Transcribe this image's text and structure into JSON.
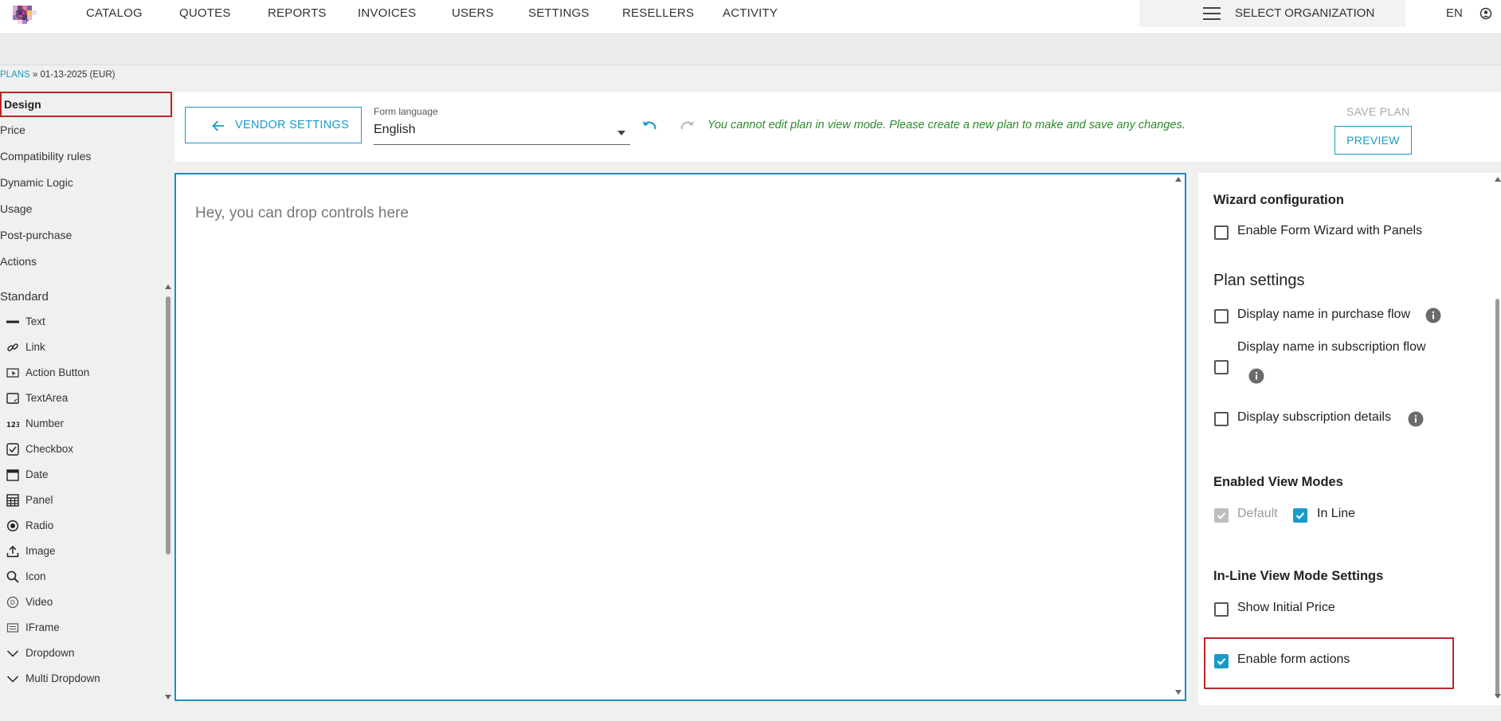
{
  "topnav": {
    "items": [
      "CATALOG",
      "QUOTES",
      "REPORTS",
      "INVOICES",
      "USERS",
      "SETTINGS",
      "RESELLERS",
      "ACTIVITY"
    ],
    "org_label": "SELECT ORGANIZATION",
    "language": "EN"
  },
  "breadcrumb": {
    "root": "PLANS",
    "separator": "»",
    "current": "01-13-2025 (EUR)"
  },
  "sidebar": {
    "sections": [
      "Design",
      "Price",
      "Compatibility rules",
      "Dynamic Logic",
      "Usage",
      "Post-purchase",
      "Actions"
    ],
    "standard_label": "Standard",
    "controls": [
      {
        "label": "Text",
        "icon": "text-icon"
      },
      {
        "label": "Link",
        "icon": "link-icon"
      },
      {
        "label": "Action Button",
        "icon": "action-button-icon"
      },
      {
        "label": "TextArea",
        "icon": "textarea-icon"
      },
      {
        "label": "Number",
        "icon": "number-icon"
      },
      {
        "label": "Checkbox",
        "icon": "checkbox-icon"
      },
      {
        "label": "Date",
        "icon": "calendar-icon"
      },
      {
        "label": "Panel",
        "icon": "panel-icon"
      },
      {
        "label": "Radio",
        "icon": "radio-icon"
      },
      {
        "label": "Image",
        "icon": "upload-icon"
      },
      {
        "label": "Icon",
        "icon": "search-icon"
      },
      {
        "label": "Video",
        "icon": "video-icon"
      },
      {
        "label": "IFrame",
        "icon": "iframe-icon"
      },
      {
        "label": "Dropdown",
        "icon": "chevron-down-icon"
      },
      {
        "label": "Multi Dropdown",
        "icon": "chevron-down-icon"
      }
    ]
  },
  "toolbar": {
    "vendor_settings_label": "VENDOR SETTINGS",
    "form_language_label": "Form language",
    "form_language_value": "English",
    "view_mode_message": "You cannot edit plan in view mode. Please create a new plan to make and save any changes.",
    "save_plan_label": "SAVE PLAN",
    "preview_label": "PREVIEW"
  },
  "canvas": {
    "drop_hint": "Hey, you can drop controls here"
  },
  "right_panel": {
    "wizard_heading": "Wizard configuration",
    "enable_wizard": {
      "label": "Enable Form Wizard with Panels",
      "checked": false
    },
    "plan_settings_title": "Plan settings",
    "display_name_purchase": {
      "label": "Display name in purchase flow",
      "checked": false
    },
    "display_name_subscription": {
      "label": "Display name in subscription flow",
      "checked": false
    },
    "display_subscription_details": {
      "label": "Display subscription details",
      "checked": false
    },
    "view_modes_heading": "Enabled View Modes",
    "mode_default": {
      "label": "Default",
      "checked": true,
      "disabled": true
    },
    "mode_inline": {
      "label": "In Line",
      "checked": true
    },
    "inline_settings_heading": "In-Line View Mode Settings",
    "show_initial_price": {
      "label": "Show Initial Price",
      "checked": false
    },
    "enable_form_actions": {
      "label": "Enable form actions",
      "checked": true
    }
  },
  "colors": {
    "accent": "#1a9ac9",
    "highlight": "#b82727",
    "message": "#2d8a2d"
  }
}
